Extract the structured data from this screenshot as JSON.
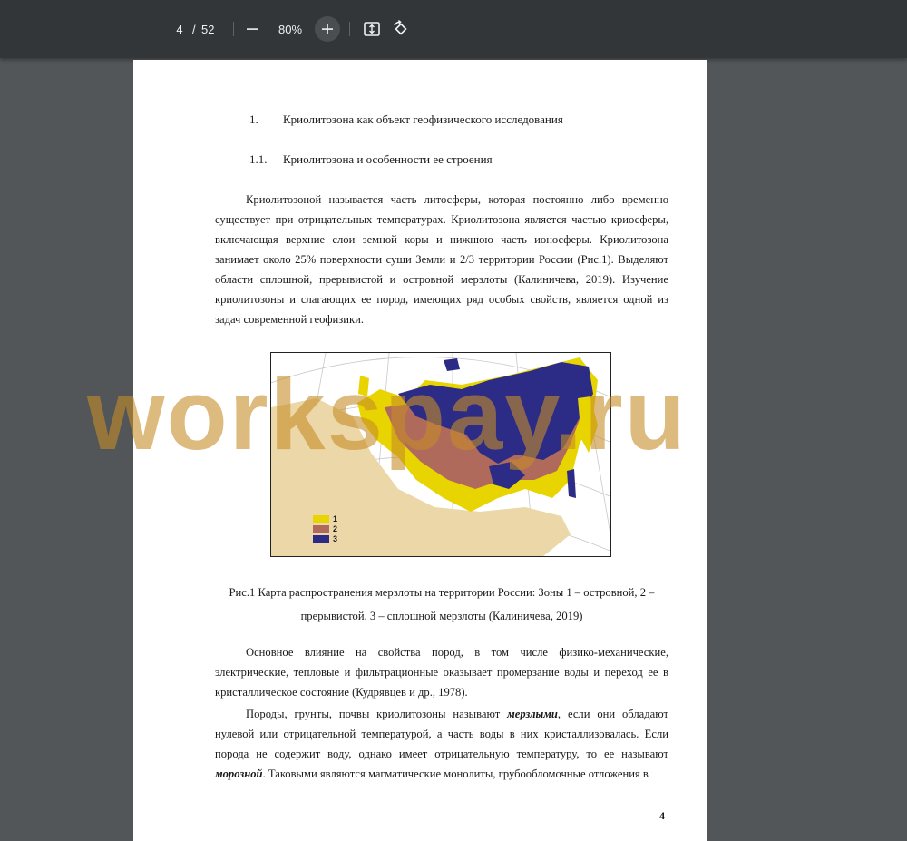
{
  "toolbar": {
    "page_current": "4",
    "page_separator": "/",
    "page_total": "52",
    "zoom_level": "80%",
    "zoom_out_icon": "minus-icon",
    "zoom_in_icon": "plus-icon",
    "fit_icon": "fit-page-icon",
    "rotate_icon": "rotate-icon"
  },
  "document": {
    "heading1": {
      "number": "1.",
      "text": "Криолитозона как объект геофизического исследования"
    },
    "heading2": {
      "number": "1.1.",
      "text": "Криолитозона и особенности ее строения"
    },
    "paragraph1": "Криолитозоной называется часть литосферы, которая постоянно либо временно существует при отрицательных температурах. Криолитозона является частью криосферы, включающая верхние слои земной коры и нижнюю часть ионосферы. Криолитозона занимает около 25% поверхности суши Земли и 2/3 территории России (Рис.1). Выделяют области сплошной, прерывистой и островной мерзлоты (Калиничева, 2019). Изучение криолитозоны и слагающих ее пород, имеющих ряд особых свойств, является одной из задач современной геофизики.",
    "figure": {
      "legend": [
        {
          "label": "1",
          "color": "#e8d400"
        },
        {
          "label": "2",
          "color": "#b06a5c"
        },
        {
          "label": "3",
          "color": "#2c2c86"
        }
      ],
      "caption": "Рис.1 Карта распространения мерзлоты на территории России: Зоны 1 – островной, 2 – прерывистой, 3 – сплошной мерзлоты (Калиничева, 2019)"
    },
    "paragraph2": "Основное влияние на свойства пород, в том числе физико-механические, электрические, тепловые и фильтрационные оказывает промерзание воды и переход ее в кристаллическое состояние (Кудрявцев и др., 1978).",
    "paragraph3": {
      "part1": "Породы, грунты, почвы криолитозоны называют ",
      "term1": "мерзлыми",
      "part2": ", если они обладают нулевой или отрицательной температурой, а часть воды в них кристаллизовалась. Если порода не содержит воду, однако имеет отрицательную температуру, то ее называют ",
      "term2": "морозной",
      "part3": ". Таковыми являются магматические монолиты, грубообломочные отложения в"
    },
    "page_number": "4"
  },
  "watermark": "workspay.ru"
}
